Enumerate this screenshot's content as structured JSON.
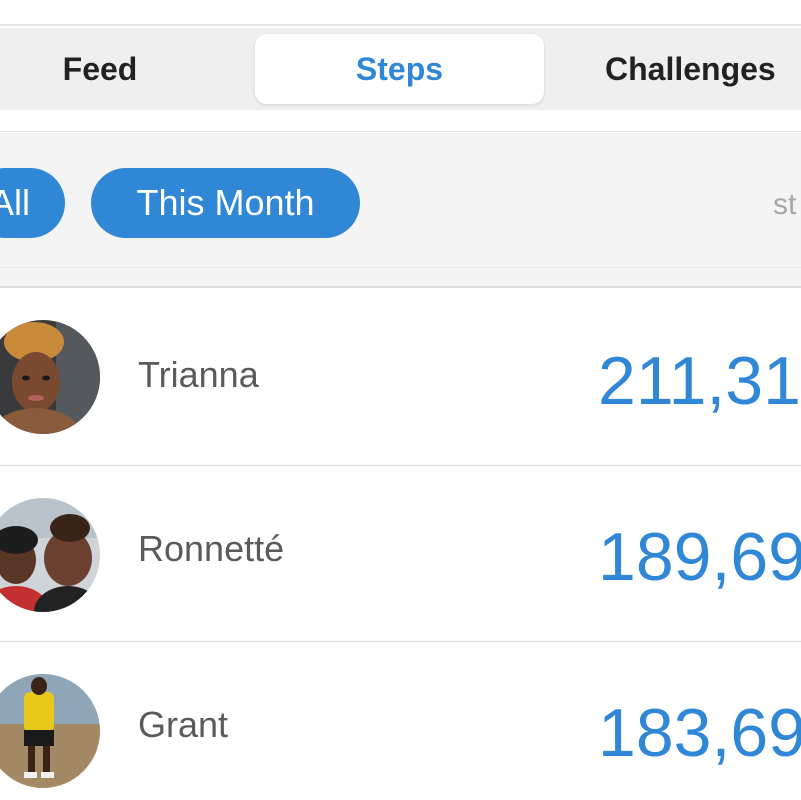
{
  "tabs": [
    {
      "label": "Feed",
      "active": false
    },
    {
      "label": "Steps",
      "active": true
    },
    {
      "label": "Challenges",
      "active": false
    }
  ],
  "filters": {
    "all_label": "All",
    "this_month_label": "This Month",
    "units_label": "st"
  },
  "leaderboard": [
    {
      "name": "Trianna",
      "steps": "211,31"
    },
    {
      "name": "Ronnetté",
      "steps": "189,69"
    },
    {
      "name": "Grant",
      "steps": "183,69"
    }
  ],
  "colors": {
    "accent": "#2f87d6",
    "segment_bg": "#efefef",
    "filter_bg": "#f4f4f4",
    "name_text": "#5a5a5a"
  }
}
